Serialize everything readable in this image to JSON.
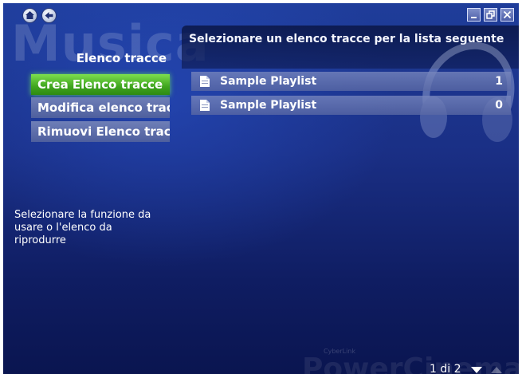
{
  "window": {
    "watermark": "Musica",
    "icons": [
      "home-icon",
      "back-icon",
      "minimize-icon",
      "restore-icon",
      "close-icon"
    ]
  },
  "sidebar": {
    "title": "Elenco tracce",
    "items": [
      {
        "label": "Crea Elenco tracce",
        "active": true
      },
      {
        "label": "Modifica elenco tracce",
        "active": false
      },
      {
        "label": "Rimuovi Elenco tracce",
        "active": false
      }
    ],
    "help": "Selezionare la funzione da usare o l'elenco da riprodurre"
  },
  "main": {
    "prompt": "Selezionare un elenco tracce per la lista seguente",
    "playlists": [
      {
        "name": "Sample Playlist",
        "count": "1",
        "icon": "document-icon"
      },
      {
        "name": "Sample Playlist",
        "count": "0",
        "icon": "document-icon"
      }
    ]
  },
  "footer": {
    "brand_small": "CyberLink",
    "brand": "PowerCinema",
    "page_indicator": "1 di 2"
  },
  "colors": {
    "background": "#1a2f85",
    "active_item": "#3fa51e",
    "menu_item": "#5a6aa8"
  }
}
